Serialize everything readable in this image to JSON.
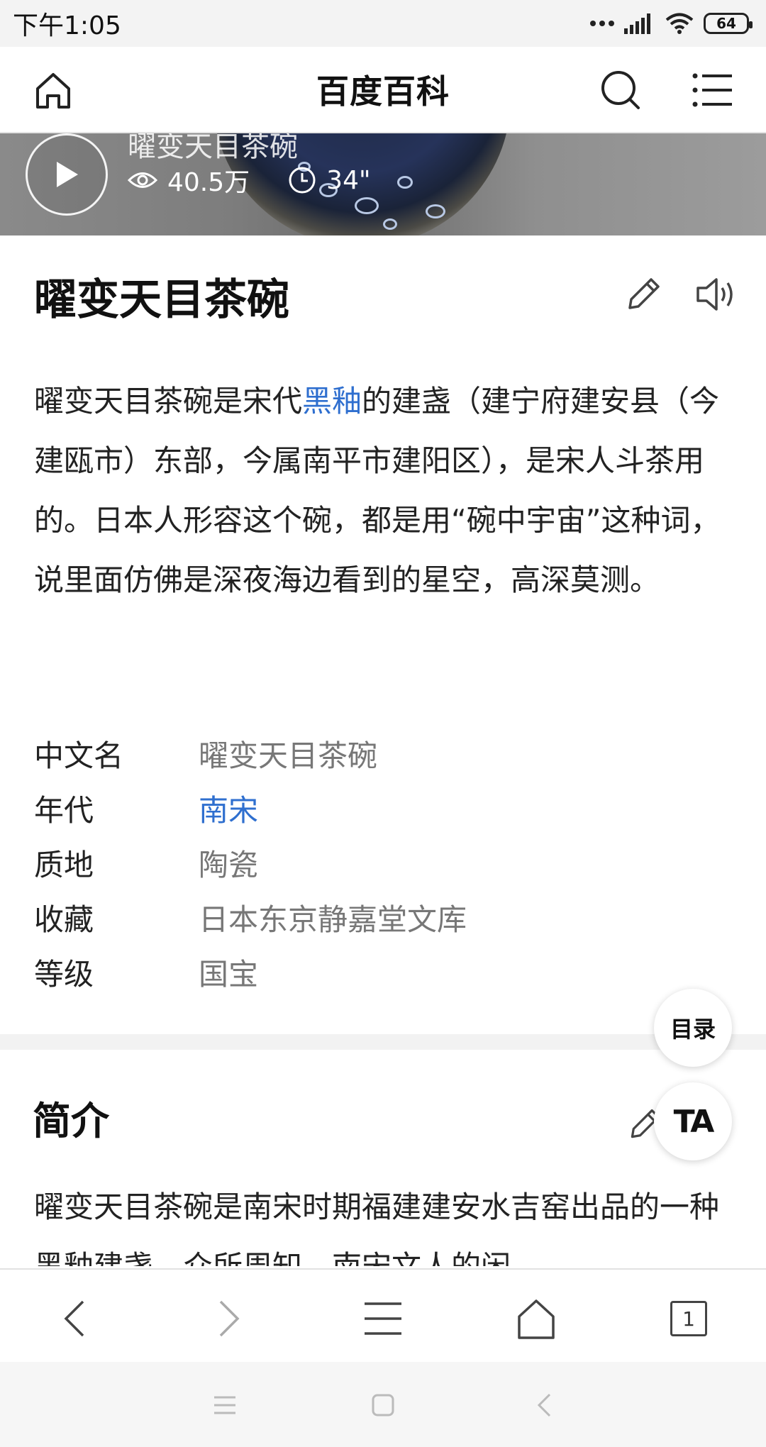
{
  "status_bar": {
    "time": "下午1:05",
    "battery": "64"
  },
  "header": {
    "title": "百度百科"
  },
  "video": {
    "title": "曜变天目茶碗",
    "views": "40.5万",
    "duration": "34\""
  },
  "article": {
    "title": "曜变天目茶碗",
    "summary_part1": "曜变天目茶碗是宋代",
    "summary_link": "黑釉",
    "summary_part2": "的建盏（建宁府建安县（今建瓯市）东部，今属南平市建阳区），是宋人斗茶用的。日本人形容这个碗，都是用“碗中宇宙”这种词，说里面仿佛是深夜海边看到的星空，高深莫测。"
  },
  "infobox": [
    {
      "label": "中文名",
      "value": "曜变天目茶碗",
      "link": false
    },
    {
      "label": "年代",
      "value": "南宋",
      "link": true
    },
    {
      "label": "质地",
      "value": "陶瓷",
      "link": false
    },
    {
      "label": "收藏",
      "value": "日本东京静嘉堂文库",
      "link": false
    },
    {
      "label": "等级",
      "value": "国宝",
      "link": false
    }
  ],
  "section": {
    "title": "简介",
    "text": "曜变天目茶碗是南宋时期福建建安水吉窑出品的一种黑釉建盏，众所周知，南宋文人的闲"
  },
  "floating": {
    "toc_label": "目录",
    "ta_label": "TA"
  },
  "browser_bar": {
    "tab_count": "1"
  },
  "icons": {
    "home": "home-icon",
    "search": "search-icon",
    "menu": "menu-icon",
    "play": "play-icon",
    "eye": "eye-icon",
    "clock": "clock-icon",
    "edit": "edit-icon",
    "speaker": "speaker-icon",
    "back": "back-icon",
    "forward": "forward-icon",
    "tabs": "tabs-icon"
  },
  "colors": {
    "link": "#2f6fcf",
    "value_gray": "#777777",
    "text": "#222222"
  }
}
